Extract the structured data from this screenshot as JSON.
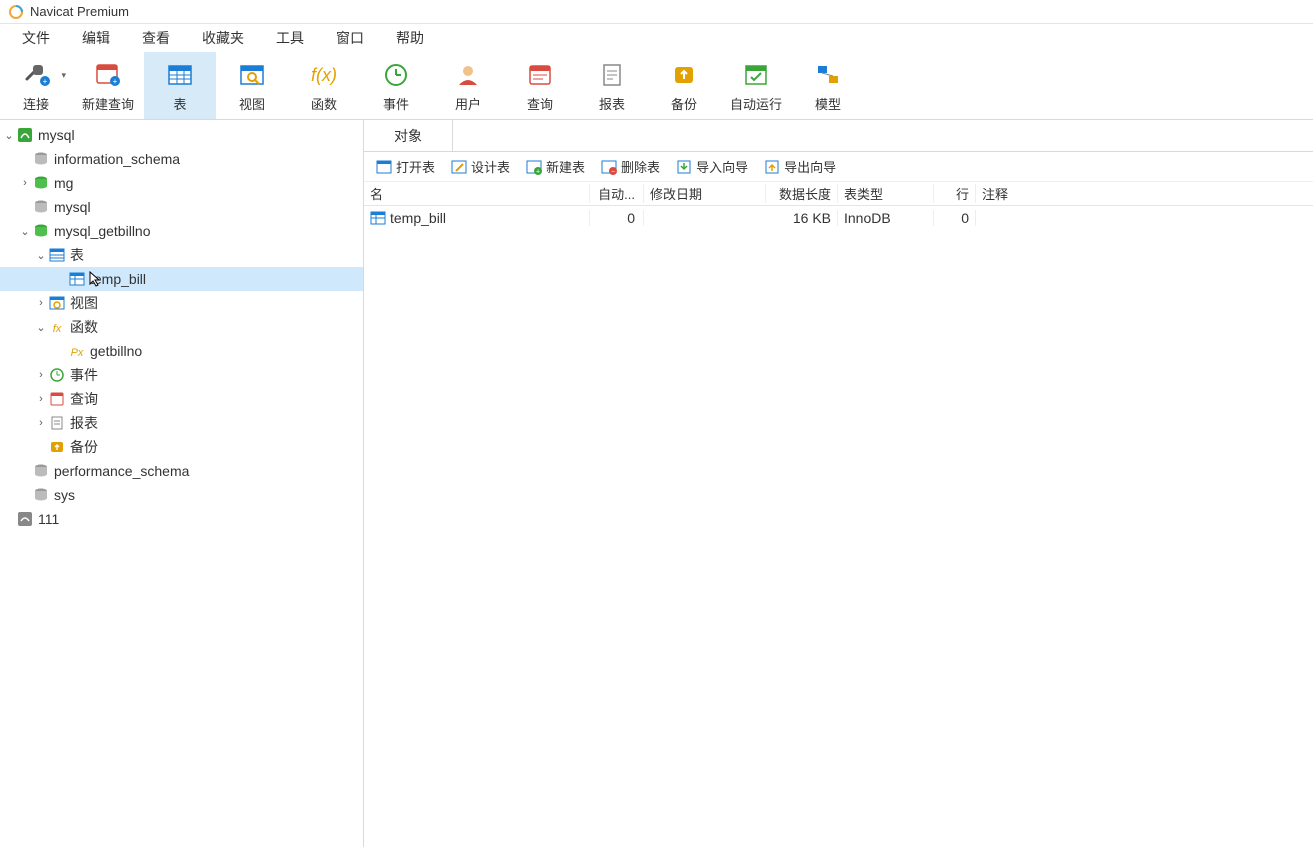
{
  "app": {
    "title": "Navicat Premium"
  },
  "menu": {
    "file": "文件",
    "edit": "编辑",
    "view": "查看",
    "favorites": "收藏夹",
    "tools": "工具",
    "window": "窗口",
    "help": "帮助"
  },
  "toolbar": {
    "connect": "连接",
    "newquery": "新建查询",
    "table": "表",
    "view": "视图",
    "function": "函数",
    "event": "事件",
    "user": "用户",
    "query": "查询",
    "report": "报表",
    "backup": "备份",
    "autorun": "自动运行",
    "model": "模型"
  },
  "tree": {
    "conn_mysql": "mysql",
    "db_information_schema": "information_schema",
    "db_mg": "mg",
    "db_mysql": "mysql",
    "db_getbillno": "mysql_getbillno",
    "node_tables": "表",
    "tbl_temp_bill": "temp_bill",
    "node_views": "视图",
    "node_functions": "函数",
    "fn_getbillno": "getbillno",
    "node_events": "事件",
    "node_queries": "查询",
    "node_reports": "报表",
    "node_backup": "备份",
    "db_performance": "performance_schema",
    "db_sys": "sys",
    "conn_111": "111"
  },
  "tabs": {
    "objects": "对象"
  },
  "objbar": {
    "open": "打开表",
    "design": "设计表",
    "new": "新建表",
    "delete": "删除表",
    "import": "导入向导",
    "export": "导出向导"
  },
  "grid": {
    "head": {
      "name": "名",
      "auto": "自动...",
      "mod": "修改日期",
      "len": "数据长度",
      "type": "表类型",
      "rows": "行",
      "comm": "注释"
    },
    "rows": [
      {
        "name": "temp_bill",
        "auto": "0",
        "mod": "",
        "len": "16 KB",
        "type": "InnoDB",
        "rows": "0",
        "comm": ""
      }
    ]
  }
}
